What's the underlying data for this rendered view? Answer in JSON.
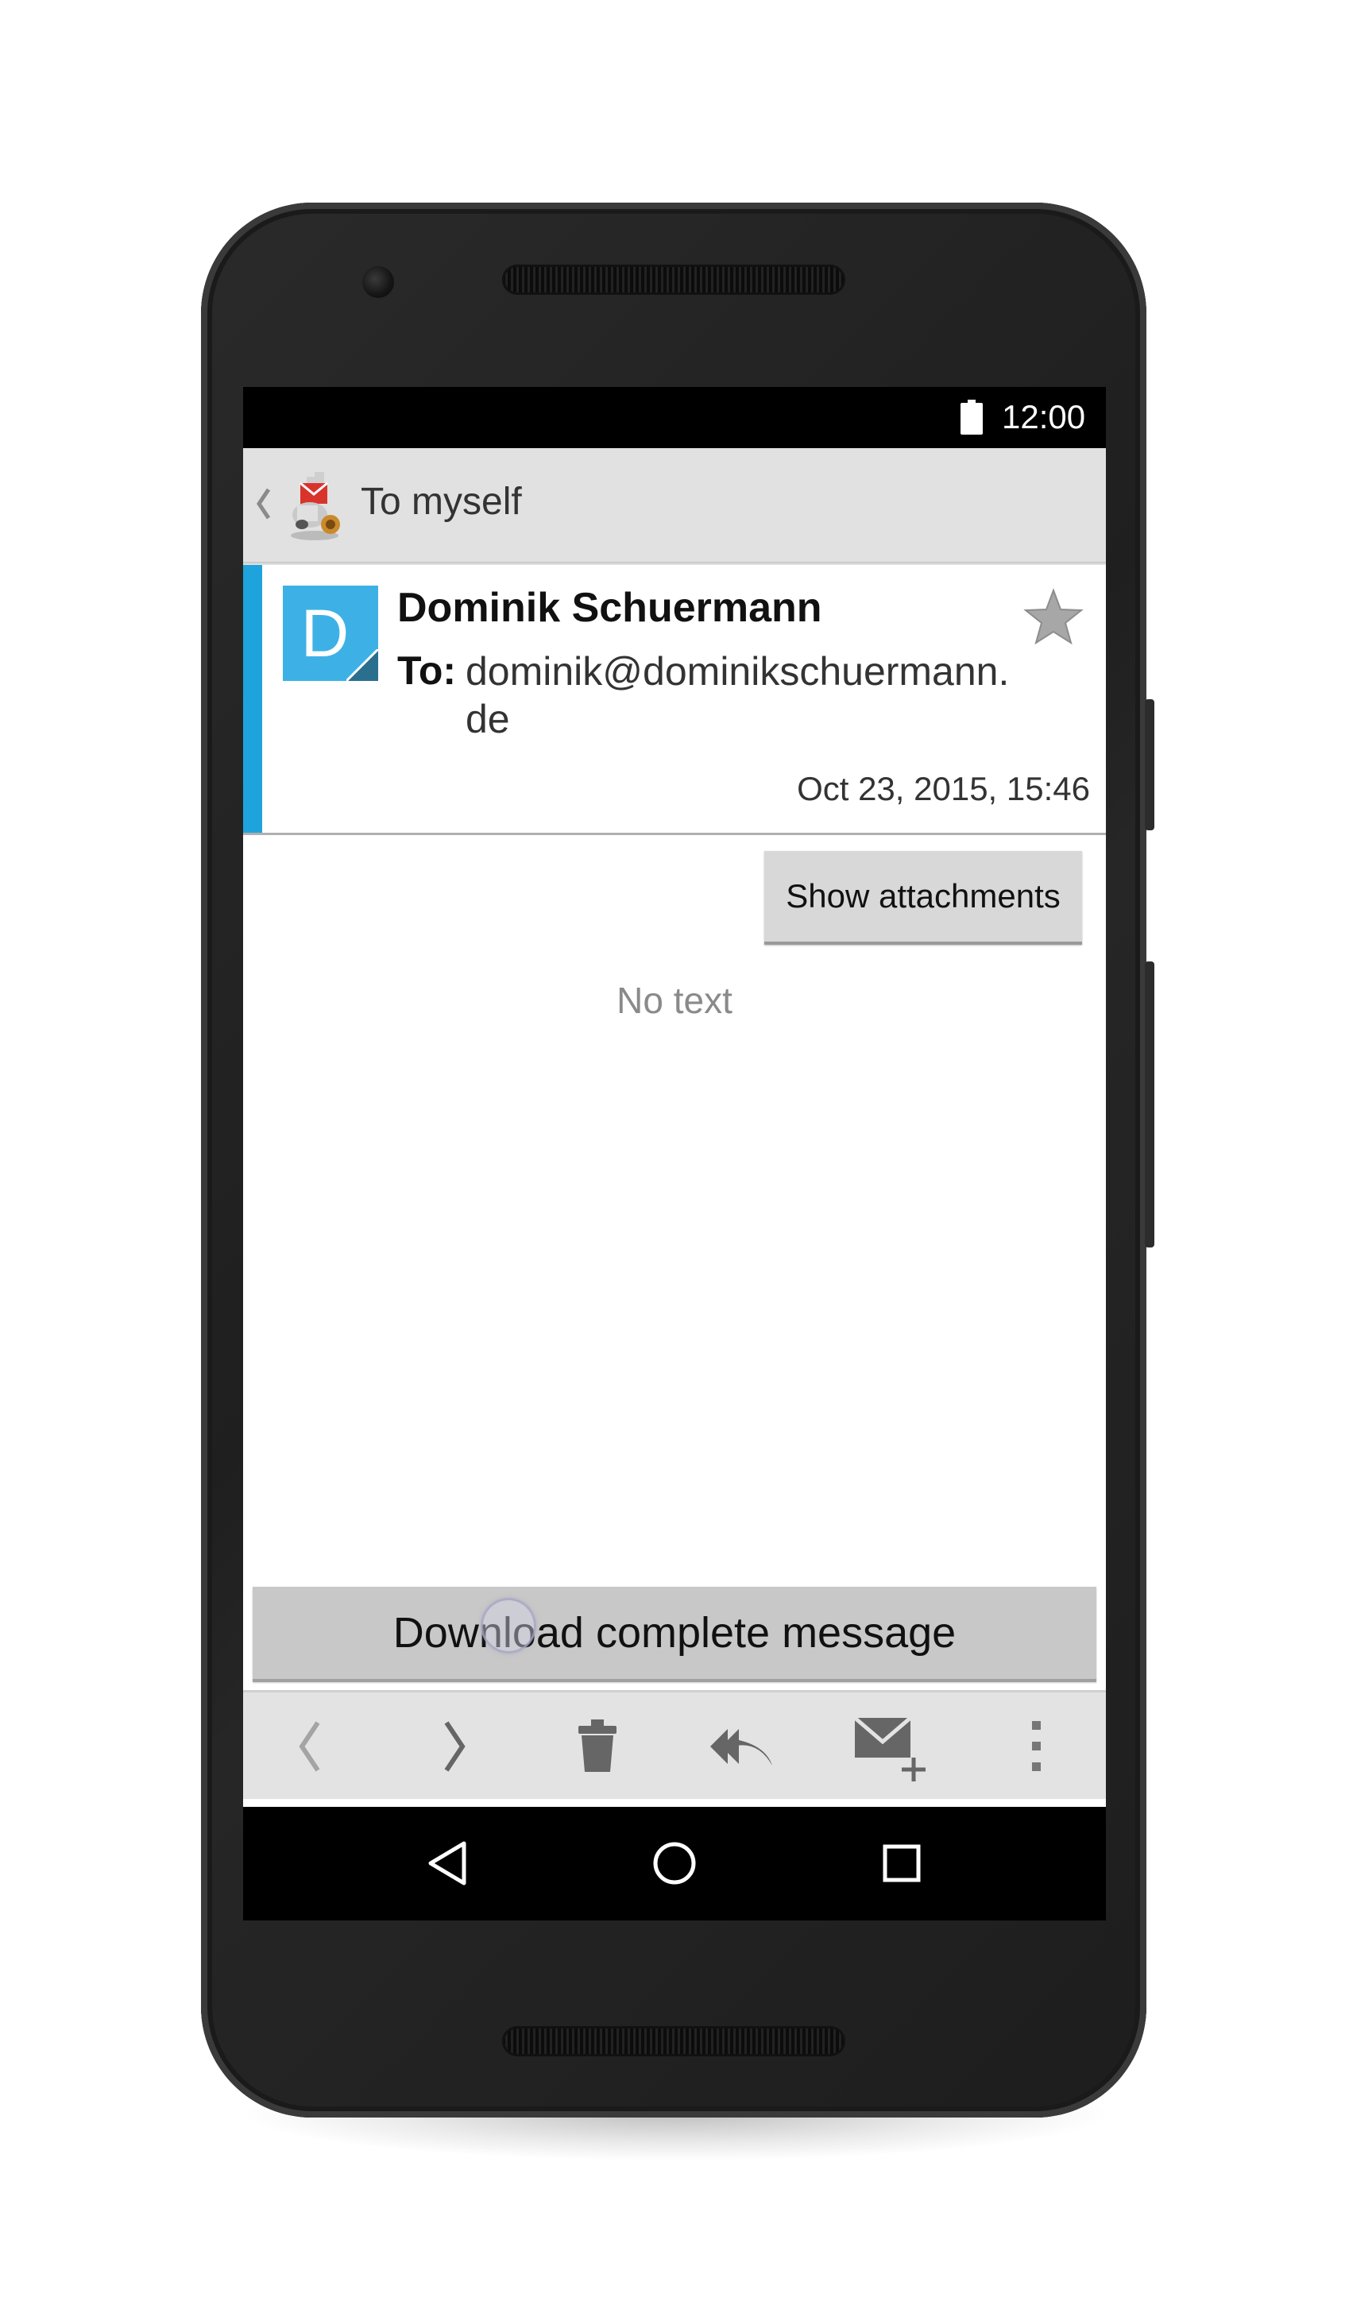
{
  "status_bar": {
    "time": "12:00",
    "battery_icon": "battery-full-icon"
  },
  "action_bar": {
    "back_icon": "chevron-left-icon",
    "app_icon": "k9-mail-dog-icon",
    "folder_title": "To myself"
  },
  "message": {
    "avatar_letter": "D",
    "from_name": "Dominik Schuermann",
    "to_label": "To:",
    "to_address": "dominik@dominikschuermann.de",
    "date": "Oct 23, 2015, 15:46",
    "star_icon": "star-icon",
    "chip_color": "#1fa3dc",
    "avatar_color": "#3db1e6"
  },
  "body": {
    "show_attachments_label": "Show attachments",
    "no_text_label": "No text",
    "download_label": "Download complete message"
  },
  "toolbar": {
    "items": [
      {
        "icon": "previous-icon"
      },
      {
        "icon": "next-icon"
      },
      {
        "icon": "trash-icon"
      },
      {
        "icon": "reply-all-icon"
      },
      {
        "icon": "compose-icon"
      },
      {
        "icon": "overflow-menu-icon"
      }
    ]
  },
  "nav_bar": {
    "items": [
      {
        "icon": "back-triangle-icon"
      },
      {
        "icon": "home-circle-icon"
      },
      {
        "icon": "recents-square-icon"
      }
    ]
  }
}
